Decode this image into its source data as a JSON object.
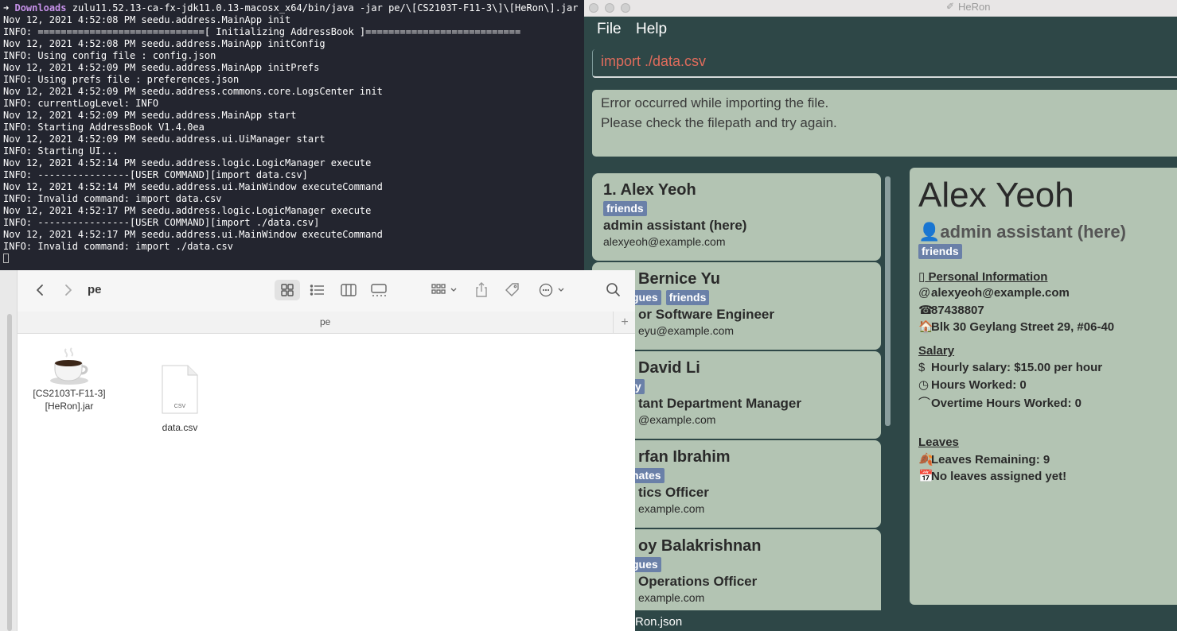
{
  "terminal": {
    "prompt": {
      "arrow": "➜",
      "dir": "Downloads",
      "command": " zulu11.52.13-ca-fx-jdk11.0.13-macosx_x64/bin/java -jar pe/\\[CS2103T-F11-3\\]\\[HeRon\\].jar"
    },
    "lines": [
      "Nov 12, 2021 4:52:08 PM seedu.address.MainApp init",
      "INFO: =============================[ Initializing AddressBook ]===========================",
      "Nov 12, 2021 4:52:08 PM seedu.address.MainApp initConfig",
      "INFO: Using config file : config.json",
      "Nov 12, 2021 4:52:09 PM seedu.address.MainApp initPrefs",
      "INFO: Using prefs file : preferences.json",
      "Nov 12, 2021 4:52:09 PM seedu.address.commons.core.LogsCenter init",
      "INFO: currentLogLevel: INFO",
      "Nov 12, 2021 4:52:09 PM seedu.address.MainApp start",
      "INFO: Starting AddressBook V1.4.0ea",
      "Nov 12, 2021 4:52:09 PM seedu.address.ui.UiManager start",
      "INFO: Starting UI...",
      "Nov 12, 2021 4:52:14 PM seedu.address.logic.LogicManager execute",
      "INFO: ----------------[USER COMMAND][import data.csv]",
      "Nov 12, 2021 4:52:14 PM seedu.address.ui.MainWindow executeCommand",
      "INFO: Invalid command: import data.csv",
      "Nov 12, 2021 4:52:17 PM seedu.address.logic.LogicManager execute",
      "INFO: ----------------[USER COMMAND][import ./data.csv]",
      "Nov 12, 2021 4:52:17 PM seedu.address.ui.MainWindow executeCommand",
      "INFO: Invalid command: import ./data.csv"
    ]
  },
  "heron": {
    "window_title": "HeRon",
    "menu": {
      "file": "File",
      "help": "Help"
    },
    "command_input": "import ./data.csv",
    "result": {
      "line1": "Error occurred while importing the file.",
      "line2": "Please check the filepath and try again."
    },
    "persons": [
      {
        "name": "1.  Alex Yeoh",
        "tags": [
          "friends"
        ],
        "role": "admin assistant (here)",
        "email": "alexyeoh@example.com"
      },
      {
        "name": "Bernice Yu",
        "tags": [
          "gues",
          "friends"
        ],
        "role": "or Software Engineer",
        "email": "eyu@example.com"
      },
      {
        "name": "David Li",
        "tags": [
          "y"
        ],
        "role": "tant Department Manager",
        "email": "@example.com"
      },
      {
        "name": "rfan Ibrahim",
        "tags": [
          "nates"
        ],
        "role": "tics Officer",
        "email": "example.com"
      },
      {
        "name": "oy Balakrishnan",
        "tags": [
          "gues"
        ],
        "role": "Operations Officer",
        "email": "example.com"
      }
    ],
    "detail": {
      "name": "Alex Yeoh",
      "role": "admin assistant (here)",
      "tag": "friends",
      "personal_heading": "Personal Information",
      "email": "alexyeoh@example.com",
      "phone": "87438807",
      "address": "Blk 30 Geylang Street 29, #06-40",
      "salary_heading": "Salary",
      "hourly_salary": "Hourly salary: $15.00 per hour",
      "hours_worked": "Hours Worked: 0",
      "overtime": "Overtime Hours Worked: 0",
      "leaves_heading": "Leaves",
      "leaves_remaining": "Leaves Remaining: 9",
      "leaves_assigned": "No leaves assigned yet!"
    },
    "status_path": "Ron.json"
  },
  "finder": {
    "folder_title": "pe",
    "path_title": "pe",
    "files": [
      {
        "name_line1": "[CS2103T-F11-3]",
        "name_line2": "[HeRon].jar",
        "icon": "java-coffee-icon"
      },
      {
        "name_line1": "data.csv",
        "icon": "csv-document-icon",
        "badge": "CSV"
      }
    ]
  }
}
